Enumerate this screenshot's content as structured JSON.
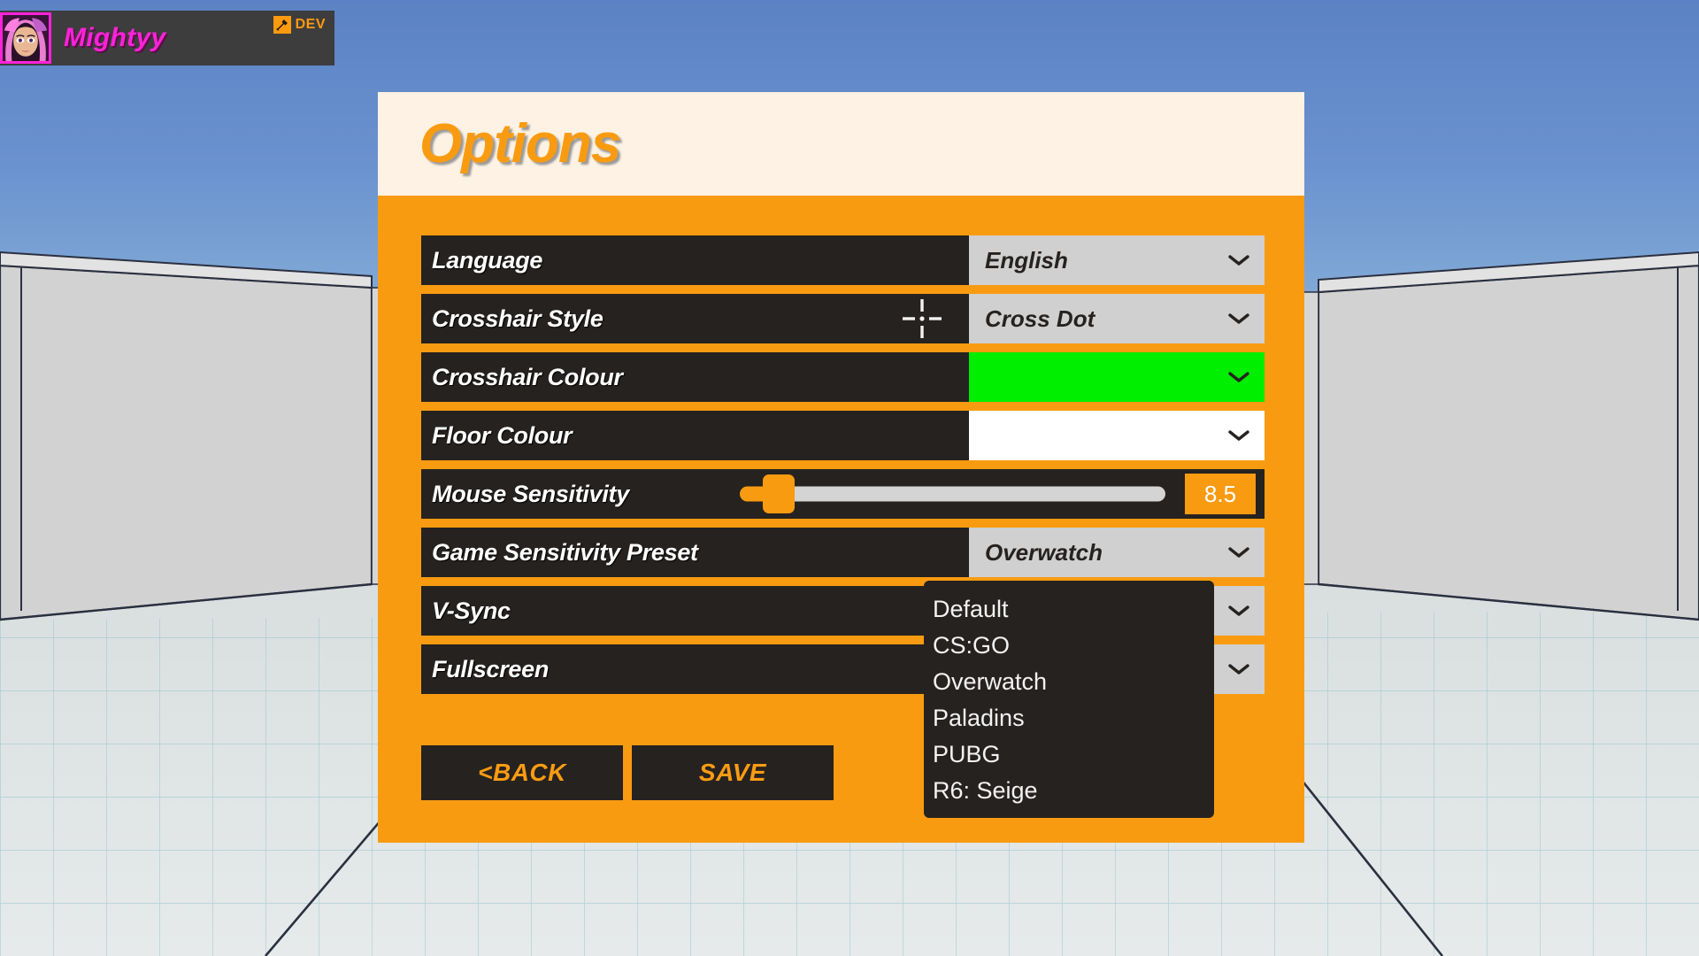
{
  "nameplate": {
    "player_name": "Mightyy",
    "badge_label": "DEV",
    "badge_icon": "hammer-icon",
    "name_color": "#ff22d8",
    "badge_color": "#ff9a0f"
  },
  "panel": {
    "title": "Options",
    "accent_color": "#f99b11",
    "header_bg": "#fdf2e3",
    "row_bg": "#262220"
  },
  "settings": [
    {
      "label": "Language",
      "type": "dropdown",
      "value": "English"
    },
    {
      "label": "Crosshair Style",
      "type": "dropdown",
      "value": "Cross Dot",
      "preview_icon": "crosshair-cross-dot-icon"
    },
    {
      "label": "Crosshair Colour",
      "type": "color",
      "value": "",
      "color": "#00ee00"
    },
    {
      "label": "Floor Colour",
      "type": "color",
      "value": "",
      "color": "#ffffff"
    },
    {
      "label": "Mouse Sensitivity",
      "type": "slider",
      "value": "8.5",
      "slider_percent": 3
    },
    {
      "label": "Game Sensitivity Preset",
      "type": "dropdown",
      "value": "Overwatch"
    },
    {
      "label": "V-Sync",
      "type": "dropdown",
      "value": ""
    },
    {
      "label": "Fullscreen",
      "type": "dropdown",
      "value": ""
    }
  ],
  "preset_dropdown": {
    "open": true,
    "options": [
      "Default",
      "CS:GO",
      "Overwatch",
      "Paladins",
      "PUBG",
      "R6: Seige"
    ]
  },
  "buttons": {
    "back_label": "<BACK",
    "save_label": "SAVE"
  }
}
